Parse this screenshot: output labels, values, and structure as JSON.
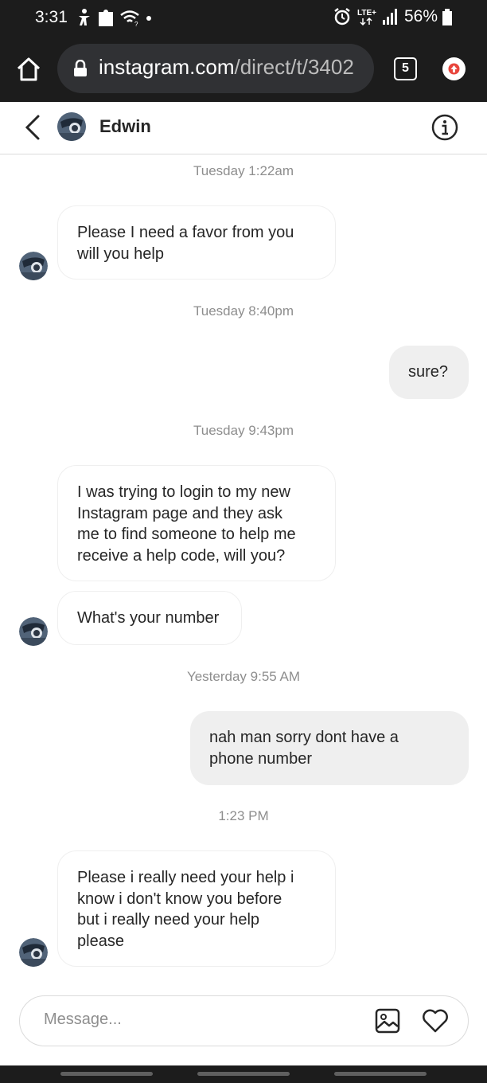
{
  "status_bar": {
    "time": "3:31",
    "network": "LTE+",
    "battery": "56%"
  },
  "browser": {
    "url_host": "instagram.com",
    "url_path": "/direct/t/3402",
    "tab_count": "5",
    "icons": [
      "home-icon",
      "lock-icon",
      "tabs-icon",
      "update-icon"
    ]
  },
  "header": {
    "name": "Edwin",
    "icons": [
      "back-arrow-icon",
      "avatar",
      "info-icon"
    ]
  },
  "messages": {
    "ts1": "Tuesday 1:22am",
    "m1": [
      "Please I need a favor from you",
      "will you help"
    ],
    "ts2": "Tuesday 8:40pm",
    "m2": "sure?",
    "ts3": "Tuesday 9:43pm",
    "m3": [
      "I was trying to login to my new",
      "Instagram page and they ask",
      "me to find someone to help me",
      "receive a help code, will you?"
    ],
    "m4": "What's your number",
    "ts4": "Yesterday 9:55 AM",
    "m5": [
      "nah man sorry dont have a",
      "phone number"
    ],
    "ts5": "1:23 PM",
    "m6": [
      "Please i really need your help i",
      "know i don't know you before",
      "but i really need your help",
      "please"
    ]
  },
  "composer": {
    "placeholder": "Message...",
    "icons": [
      "image-icon",
      "heart-icon"
    ]
  },
  "colors": {
    "system_bar": "#1c1c1c",
    "outgoing_bubble": "#efefef",
    "timestamp": "#8e8e8e",
    "text": "#262626"
  }
}
